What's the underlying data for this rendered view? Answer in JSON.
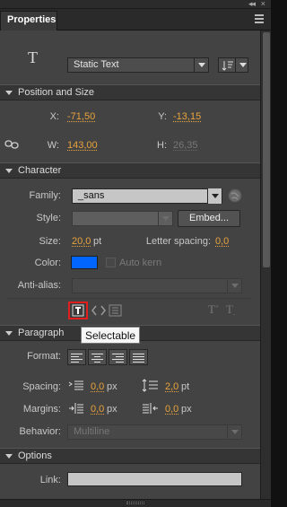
{
  "window": {
    "collapse_glyph": "◂◂",
    "close_glyph": "×"
  },
  "tab": {
    "label": "Properties"
  },
  "instance": {
    "type_icon": "T",
    "text_type": "Static Text",
    "orientation_icon": "text-orientation-icon"
  },
  "position_size": {
    "header": "Position and Size",
    "x_label": "X:",
    "x_value": "-71,50",
    "y_label": "Y:",
    "y_value": "-13,15",
    "w_label": "W:",
    "w_value": "143,00",
    "h_label": "H:",
    "h_value": "26,35",
    "link_icon": "chain-link-icon"
  },
  "character": {
    "header": "Character",
    "family_label": "Family:",
    "family_value": "_sans",
    "style_label": "Style:",
    "style_value": "",
    "embed_label": "Embed...",
    "size_label": "Size:",
    "size_value": "20,0",
    "size_unit": "pt",
    "letter_spacing_label": "Letter spacing:",
    "letter_spacing_value": "0,0",
    "color_label": "Color:",
    "color_value": "#0066ff",
    "auto_kern_label": "Auto kern",
    "antialias_label": "Anti-alias:",
    "antialias_value": "",
    "superscript_glyph": "T",
    "subscript_glyph": "T"
  },
  "tooltip": {
    "text": "Selectable"
  },
  "paragraph": {
    "header": "Paragraph",
    "format_label": "Format:",
    "spacing_label": "Spacing:",
    "indent_value": "0,0",
    "indent_unit": "px",
    "line_spacing_value": "2,0",
    "line_spacing_unit": "pt",
    "margins_label": "Margins:",
    "left_margin_value": "0,0",
    "left_margin_unit": "px",
    "right_margin_value": "0,0",
    "right_margin_unit": "px",
    "behavior_label": "Behavior:",
    "behavior_value": "Multiline"
  },
  "options": {
    "header": "Options",
    "link_label": "Link:",
    "link_value": ""
  }
}
